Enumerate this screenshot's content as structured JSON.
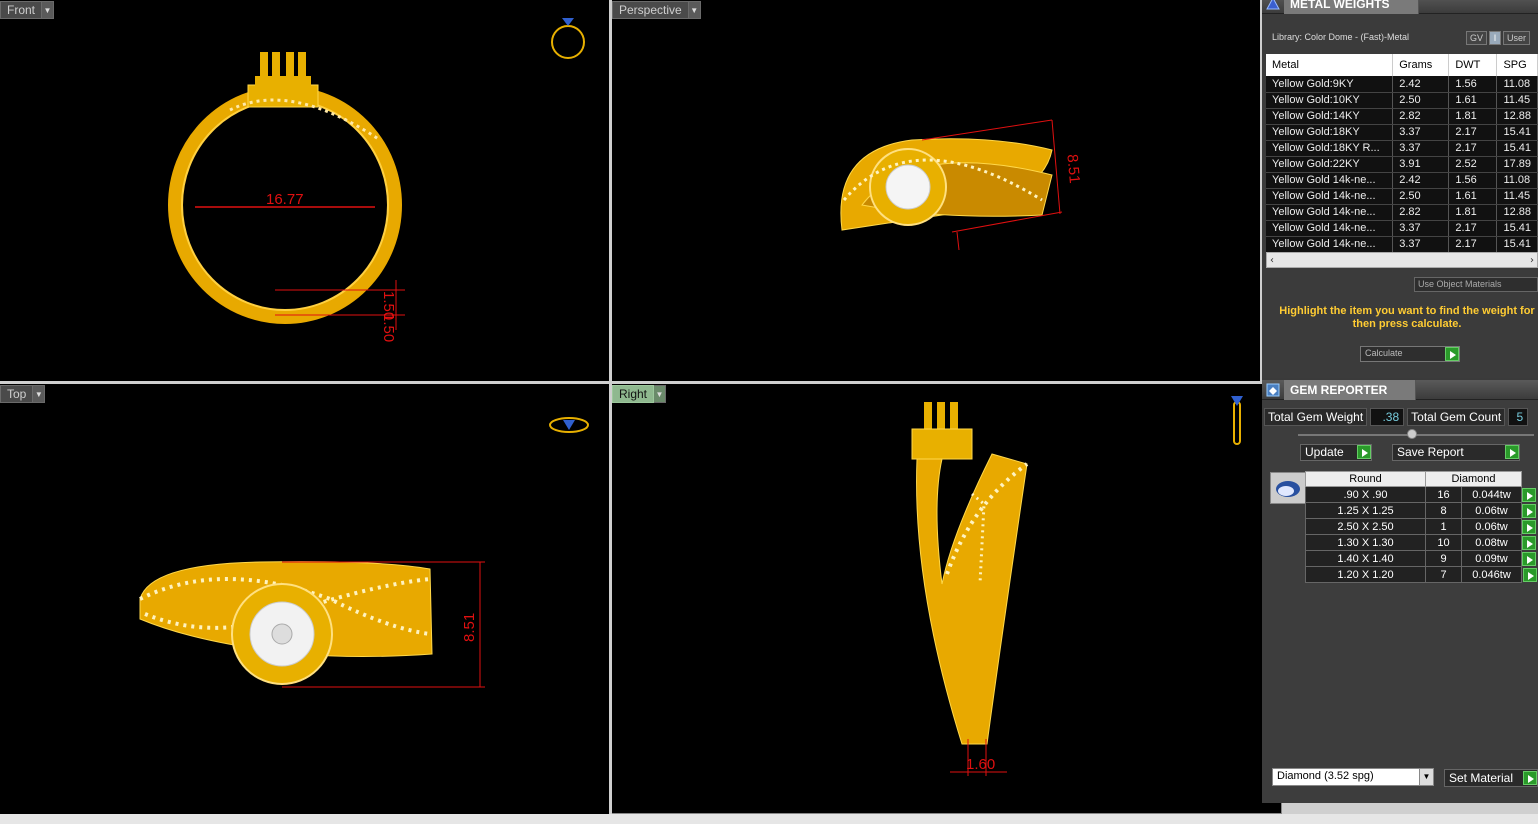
{
  "viewports": {
    "front": {
      "label": "Front",
      "dims": [
        "16.77",
        "1.50",
        "1.50"
      ]
    },
    "perspective": {
      "label": "Perspective",
      "dims": [
        "8.51"
      ]
    },
    "top": {
      "label": "Top",
      "dims": [
        "8.51"
      ]
    },
    "right": {
      "label": "Right",
      "dims": [
        "1.60"
      ]
    }
  },
  "metal_weights": {
    "title": "METAL WEIGHTS",
    "library": "Library: Color Dome - (Fast)-Metal",
    "gv_label": "GV",
    "toggle_label": "I",
    "user_label": "User",
    "columns": [
      "Metal",
      "Grams",
      "DWT",
      "SPG"
    ],
    "rows": [
      [
        "Yellow Gold:9KY",
        "2.42",
        "1.56",
        "11.08"
      ],
      [
        "Yellow Gold:10KY",
        "2.50",
        "1.61",
        "11.45"
      ],
      [
        "Yellow Gold:14KY",
        "2.82",
        "1.81",
        "12.88"
      ],
      [
        "Yellow Gold:18KY",
        "3.37",
        "2.17",
        "15.41"
      ],
      [
        "Yellow Gold:18KY R...",
        "3.37",
        "2.17",
        "15.41"
      ],
      [
        "Yellow Gold:22KY",
        "3.91",
        "2.52",
        "17.89"
      ],
      [
        "Yellow Gold 14k-ne...",
        "2.42",
        "1.56",
        "11.08"
      ],
      [
        "Yellow Gold 14k-ne...",
        "2.50",
        "1.61",
        "11.45"
      ],
      [
        "Yellow Gold 14k-ne...",
        "2.82",
        "1.81",
        "12.88"
      ],
      [
        "Yellow Gold 14k-ne...",
        "3.37",
        "2.17",
        "15.41"
      ],
      [
        "Yellow Gold 14k-ne...",
        "3.37",
        "2.17",
        "15.41"
      ]
    ],
    "use_object_materials": "Use Object Materials",
    "hint": "Highlight the item you want to find the weight for then press calculate.",
    "calculate": "Calculate"
  },
  "gem_reporter": {
    "title": "GEM REPORTER",
    "total_weight_label": "Total Gem Weight",
    "total_weight_value": ".38",
    "total_count_label": "Total Gem Count",
    "total_count_value": "5",
    "update": "Update",
    "save_report": "Save Report",
    "columns": [
      "Round",
      "Diamond"
    ],
    "rows": [
      [
        ".90 X .90",
        "16",
        "0.044tw"
      ],
      [
        "1.25 X 1.25",
        "8",
        "0.06tw"
      ],
      [
        "2.50 X 2.50",
        "1",
        "0.06tw"
      ],
      [
        "1.30 X 1.30",
        "10",
        "0.08tw"
      ],
      [
        "1.40 X 1.40",
        "9",
        "0.09tw"
      ],
      [
        "1.20 X 1.20",
        "7",
        "0.046tw"
      ]
    ],
    "material": "Diamond    (3.52 spg)",
    "set_material": "Set Material"
  },
  "colors": {
    "gold": "#e8b000",
    "dimension": "#e01010",
    "accent": "#ffcc33",
    "go": "#2a9a2a"
  }
}
